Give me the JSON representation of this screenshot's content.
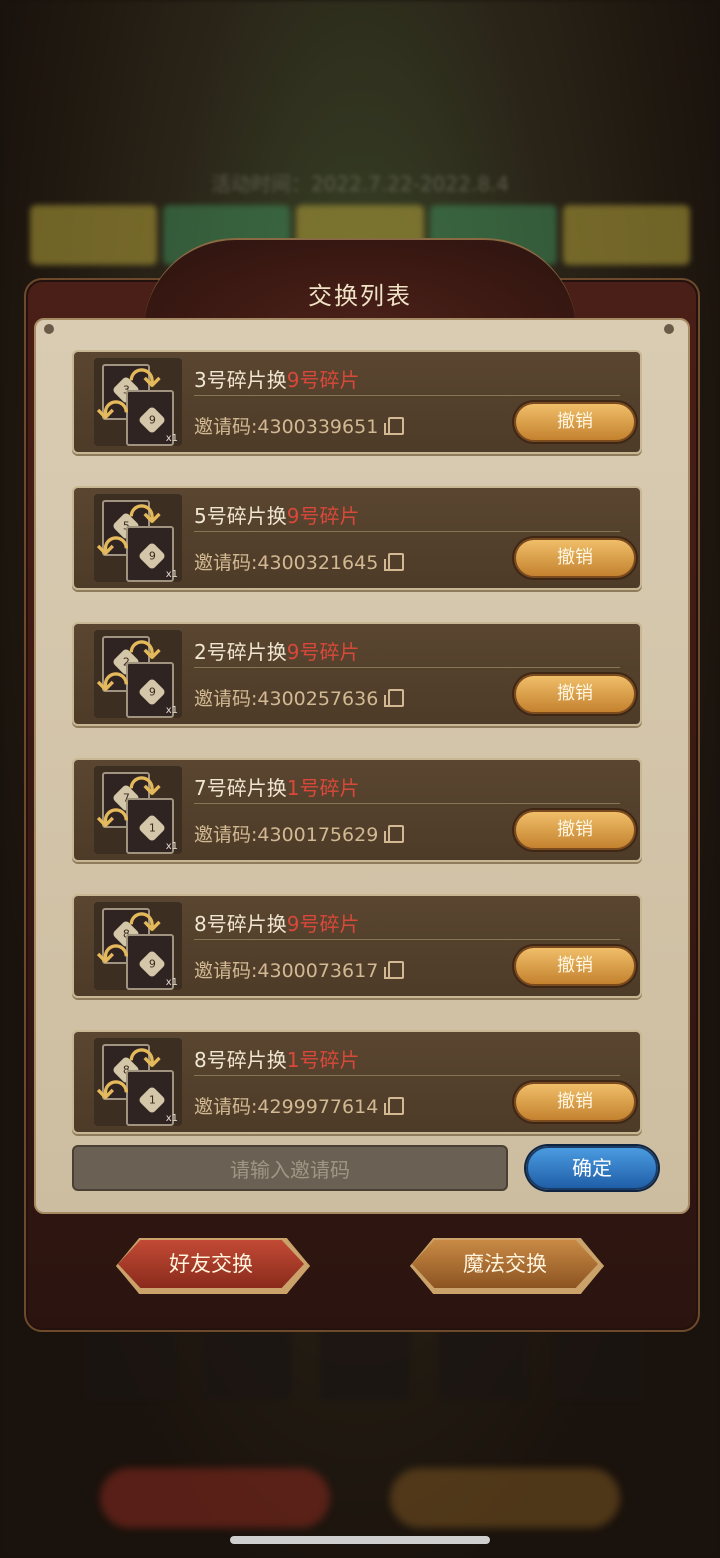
{
  "background": {
    "activity_time": "活动时间：2022.7.22-2022.8.4"
  },
  "dialog": {
    "title": "交换列表",
    "rows": [
      {
        "from": "3号碎片换",
        "to": "9号碎片",
        "code": "邀请码:4300339651",
        "from_num": "3",
        "to_num": "9",
        "count": "x1",
        "cancel": "撤销"
      },
      {
        "from": "5号碎片换",
        "to": "9号碎片",
        "code": "邀请码:4300321645",
        "from_num": "5",
        "to_num": "9",
        "count": "x1",
        "cancel": "撤销"
      },
      {
        "from": "2号碎片换",
        "to": "9号碎片",
        "code": "邀请码:4300257636",
        "from_num": "2",
        "to_num": "9",
        "count": "x1",
        "cancel": "撤销"
      },
      {
        "from": "7号碎片换",
        "to": "1号碎片",
        "code": "邀请码:4300175629",
        "from_num": "7",
        "to_num": "1",
        "count": "x1",
        "cancel": "撤销"
      },
      {
        "from": "8号碎片换",
        "to": "9号碎片",
        "code": "邀请码:4300073617",
        "from_num": "8",
        "to_num": "9",
        "count": "x1",
        "cancel": "撤销"
      },
      {
        "from": "8号碎片换",
        "to": "1号碎片",
        "code": "邀请码:4299977614",
        "from_num": "8",
        "to_num": "1",
        "count": "x1",
        "cancel": "撤销"
      }
    ],
    "input_placeholder": "请输入邀请码",
    "confirm": "确定",
    "friend_exchange": "好友交换",
    "magic_exchange": "魔法交换"
  },
  "colors": {
    "highlight_red": "#d9483a",
    "confirm_blue": "#1f5fa8",
    "cancel_gold": "#c4822f"
  }
}
